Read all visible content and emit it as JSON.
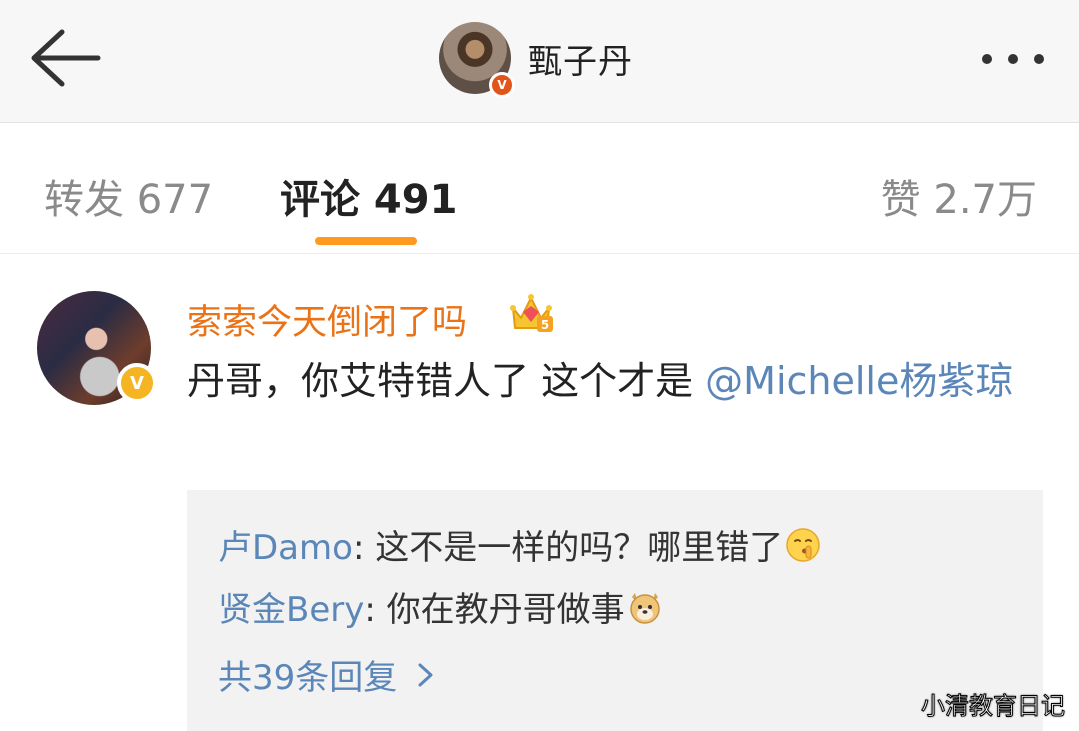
{
  "header": {
    "title": "甄子丹",
    "avatar_icon": "user-avatar",
    "verified_icon": "verified-badge",
    "back_icon": "arrow-left-icon",
    "more_icon": "more-horizontal-icon"
  },
  "tabs": [
    {
      "label": "转发 677"
    },
    {
      "label": "评论 491",
      "active": true
    },
    {
      "label": "赞 2.7万"
    }
  ],
  "comment": {
    "author": "索索今天倒闭了吗",
    "author_color": "#eb7317",
    "badge_icon": "crown-level-5-icon",
    "text_before": "丹哥，你艾特错人了  这个才是 ",
    "mention": "@Michelle杨紫琼",
    "mention_color": "#5b86b8",
    "verified_icon": "verified-gold-badge",
    "replies": [
      {
        "author": "卢Damo",
        "text": ": 这不是一样的吗？哪里错了",
        "emoji": "shush-emoji"
      },
      {
        "author": "贤金Bery",
        "text": ": 你在教丹哥做事",
        "emoji": "doge-emoji"
      }
    ],
    "more_replies": "共39条回复"
  },
  "watermark": "小清教育日记",
  "colors": {
    "accent": "#ff9a1e",
    "link": "#5b86b8",
    "verified_red": "#e3541a",
    "verified_gold": "#f5b522"
  }
}
